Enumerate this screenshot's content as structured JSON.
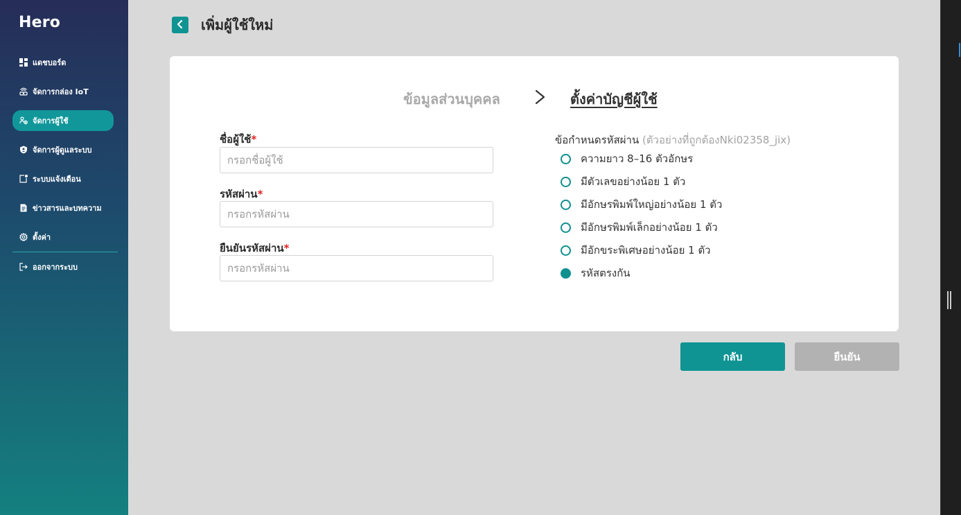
{
  "sidebar": {
    "brand": "Hero",
    "items": [
      {
        "label": "แดชบอร์ด",
        "icon": "dashboard-icon"
      },
      {
        "label": "จัดการกล่อง IoT",
        "icon": "router-icon"
      },
      {
        "label": "จัดการผู้ใช้",
        "icon": "users-icon",
        "active": true
      },
      {
        "label": "จัดการผู้ดูแลระบบ",
        "icon": "admin-shield-icon"
      },
      {
        "label": "ระบบแจ้งเตือน",
        "icon": "notification-icon"
      },
      {
        "label": "ข่าวสารและบทความ",
        "icon": "article-icon"
      },
      {
        "label": "ตั้งค่า",
        "icon": "gear-icon"
      }
    ],
    "logout": {
      "label": "ออกจากระบบ",
      "icon": "logout-icon"
    }
  },
  "page": {
    "title": "เพิ่มผู้ใช้ใหม่"
  },
  "steps": {
    "step1": "ข้อมูลส่วนบุคคล",
    "step2": "ตั้งค่าบัญชีผู้ใช้",
    "active_step": 2
  },
  "form": {
    "username": {
      "label": "ชื่อผู้ใช้",
      "required_mark": "*",
      "placeholder": "กรอกชื่อผู้ใช้",
      "value": ""
    },
    "password": {
      "label": "รหัสผ่าน",
      "required_mark": "*",
      "placeholder": "กรอกรหัสผ่าน",
      "value": ""
    },
    "confirm_password": {
      "label": "ยืนยันรหัสผ่าน",
      "required_mark": "*",
      "placeholder": "กรอกรหัสผ่าน",
      "value": ""
    }
  },
  "requirements": {
    "header": "ข้อกำหนดรหัสผ่าน",
    "example": "(ตัวอย่างที่ถูกต้องNki02358_jix)",
    "items": [
      {
        "text": "ความยาว 8–16 ตัวอักษร",
        "met": false
      },
      {
        "text": "มีตัวเลขอย่างน้อย 1 ตัว",
        "met": false
      },
      {
        "text": "มีอักษรพิมพ์ใหญ่อย่างน้อย 1 ตัว",
        "met": false
      },
      {
        "text": "มีอักษรพิมพ์เล็กอย่างน้อย 1 ตัว",
        "met": false
      },
      {
        "text": "มีอักขระพิเศษอย่างน้อย 1 ตัว",
        "met": false
      },
      {
        "text": "รหัสตรงกัน",
        "met": true
      }
    ]
  },
  "buttons": {
    "back": "กลับ",
    "confirm": "ยืนยัน"
  },
  "colors": {
    "accent": "#0f9393",
    "disabled": "#b2b2b2",
    "required": "#e02424"
  }
}
